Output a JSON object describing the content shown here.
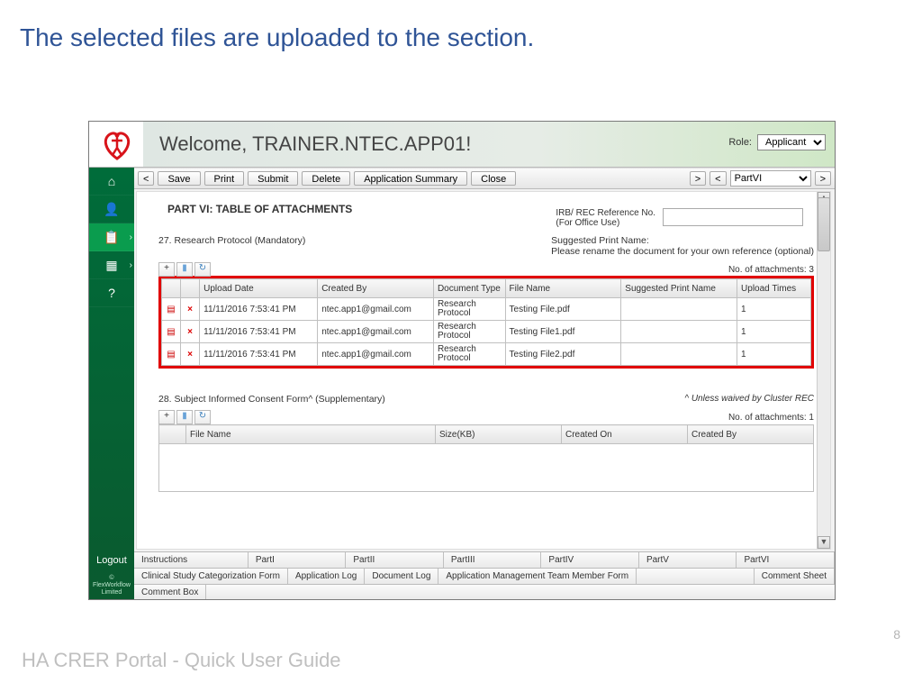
{
  "slide": {
    "title": "The selected files are uploaded to the section.",
    "footer": "HA CRER Portal - Quick User Guide",
    "page": "8"
  },
  "banner": {
    "welcome": "Welcome, TRAINER.NTEC.APP01!",
    "role_label": "Role:",
    "role_value": "Applicant"
  },
  "toolbar": {
    "save": "Save",
    "print": "Print",
    "submit": "Submit",
    "delete": "Delete",
    "app_summary": "Application Summary",
    "close": "Close",
    "part_select": "PartVI"
  },
  "sidebar": {
    "logout": "Logout",
    "copyright": "© FlexWorkflow Limited"
  },
  "content": {
    "part_title": "PART VI: TABLE OF ATTACHMENTS",
    "ref_label": "IRB/ REC Reference No.\n(For Office Use)",
    "s27": {
      "label": "27. Research Protocol (Mandatory)",
      "hint_title": "Suggested Print Name:",
      "hint_body": "Please rename the document for your own reference (optional)",
      "count_label": "No. of attachments: 3",
      "headers": [
        "",
        "",
        "Upload Date",
        "Created By",
        "Document Type",
        "File Name",
        "Suggested Print Name",
        "Upload Times"
      ],
      "rows": [
        {
          "date": "11/11/2016 7:53:41 PM",
          "by": "ntec.app1@gmail.com",
          "type": "Research Protocol",
          "file": "Testing File.pdf",
          "print": "",
          "times": "1"
        },
        {
          "date": "11/11/2016 7:53:41 PM",
          "by": "ntec.app1@gmail.com",
          "type": "Research Protocol",
          "file": "Testing File1.pdf",
          "print": "",
          "times": "1"
        },
        {
          "date": "11/11/2016 7:53:41 PM",
          "by": "ntec.app1@gmail.com",
          "type": "Research Protocol",
          "file": "Testing File2.pdf",
          "print": "",
          "times": "1"
        }
      ]
    },
    "s28": {
      "label": "28. Subject Informed Consent Form^ (Supplementary)",
      "note": "^ Unless waived by Cluster REC",
      "count_label": "No. of attachments: 1",
      "headers": [
        "",
        "File Name",
        "Size(KB)",
        "Created On",
        "Created By"
      ]
    }
  },
  "tabs": {
    "row1": [
      "Instructions",
      "PartI",
      "PartII",
      "PartIII",
      "PartIV",
      "PartV",
      "PartVI"
    ],
    "row2": [
      "Clinical Study Categorization Form",
      "Application Log",
      "Document Log",
      "Application Management Team Member Form",
      "Comment Sheet"
    ],
    "row3": [
      "Comment Box"
    ]
  }
}
